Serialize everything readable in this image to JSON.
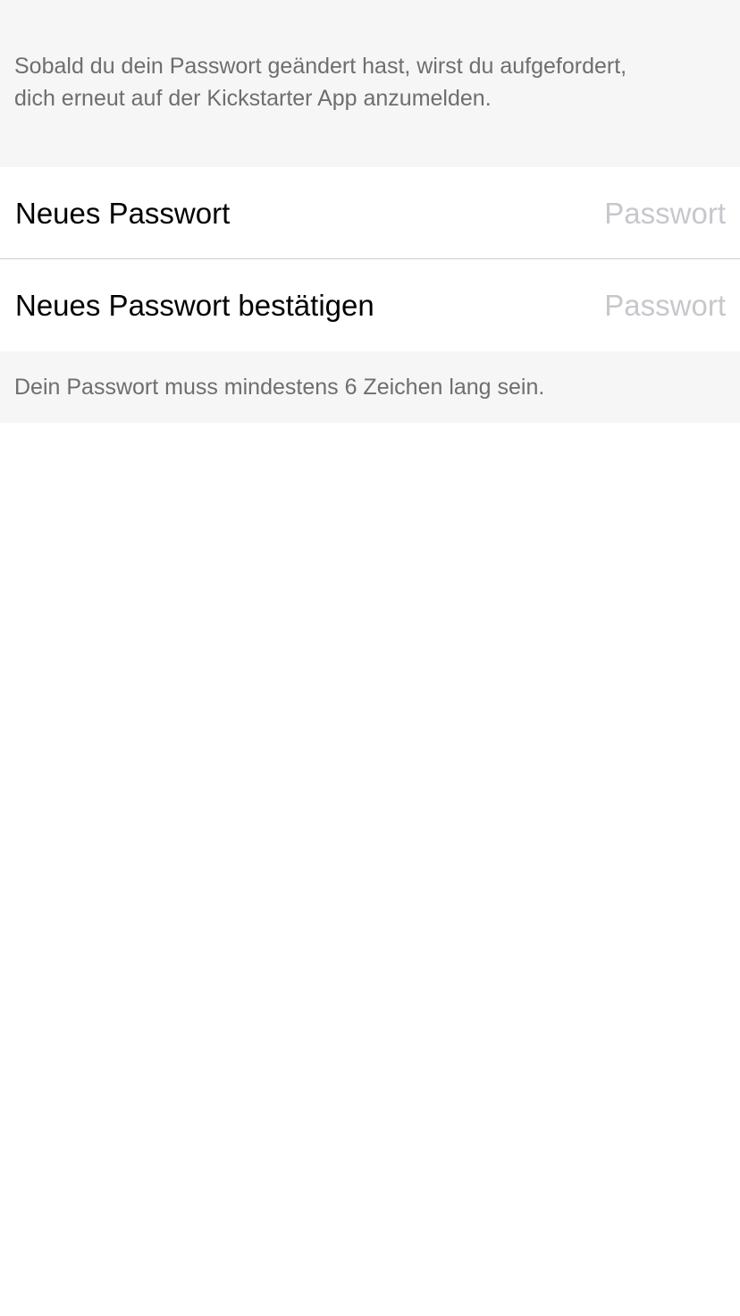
{
  "header": {
    "info_line_1": "Sobald du dein Passwort geändert hast, wirst du aufgefordert,",
    "info_line_2": "dich erneut auf der Kickstarter App anzumelden."
  },
  "fields": [
    {
      "label": "Neues Passwort",
      "value": "",
      "placeholder": "Passwort"
    },
    {
      "label": "Neues Passwort bestätigen",
      "value": "",
      "placeholder": "Passwort"
    }
  ],
  "footer": {
    "note": "Dein Passwort muss mindestens 6 Zeichen lang sein."
  },
  "colors": {
    "section_background": "#f6f6f6",
    "secondary_text": "#6e6e6e",
    "placeholder_text": "#c7c7cc",
    "separator": "#cccccc"
  }
}
